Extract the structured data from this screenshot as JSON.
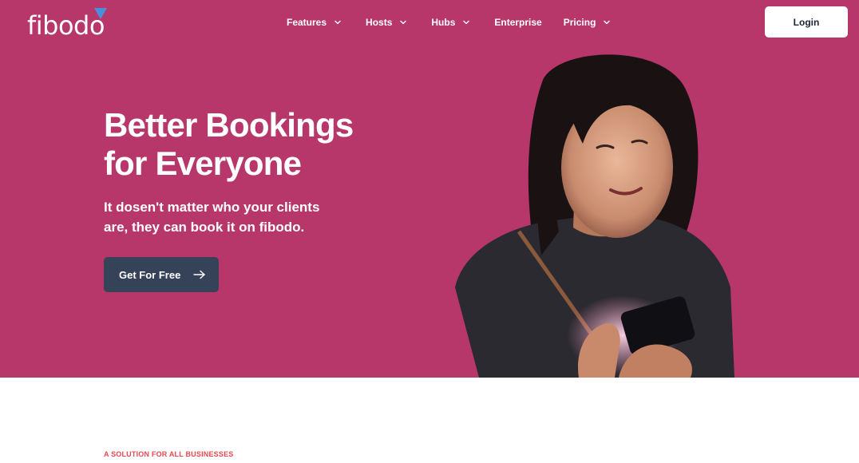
{
  "brand": {
    "name": "fibodo",
    "primary_color": "#b8376b",
    "accent_triangle_color": "#4a90d9",
    "button_dark_color": "#364258"
  },
  "nav": {
    "items": [
      {
        "label": "Features",
        "has_dropdown": true
      },
      {
        "label": "Hosts",
        "has_dropdown": true
      },
      {
        "label": "Hubs",
        "has_dropdown": true
      },
      {
        "label": "Enterprise",
        "has_dropdown": false
      },
      {
        "label": "Pricing",
        "has_dropdown": true
      }
    ],
    "login_label": "Login"
  },
  "hero": {
    "headline_line1": "Better Bookings",
    "headline_line2": "for Everyone",
    "subhead_line1": "It dosen't matter who your clients",
    "subhead_line2": "are, they can book it on fibodo.",
    "cta_label": "Get For Free",
    "cta_icon": "arrow-right-icon"
  },
  "section": {
    "eyebrow": "A SOLUTION FOR ALL BUSINESSES"
  }
}
